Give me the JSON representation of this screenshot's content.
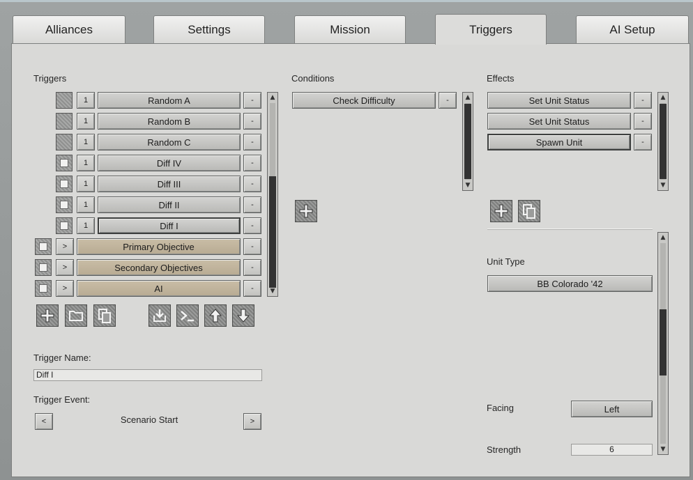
{
  "tabs": [
    {
      "label": "Alliances"
    },
    {
      "label": "Settings"
    },
    {
      "label": "Mission"
    },
    {
      "label": "Triggers"
    },
    {
      "label": "AI Setup"
    }
  ],
  "active_tab": "Triggers",
  "triggers": {
    "heading": "Triggers",
    "items": [
      {
        "count": "1",
        "label": "Random A",
        "checked": false
      },
      {
        "count": "1",
        "label": "Random B",
        "checked": false
      },
      {
        "count": "1",
        "label": "Random C",
        "checked": false
      },
      {
        "count": "1",
        "label": "Diff IV",
        "checked": true
      },
      {
        "count": "1",
        "label": "Diff III",
        "checked": true
      },
      {
        "count": "1",
        "label": "Diff II",
        "checked": true
      },
      {
        "count": "1",
        "label": "Diff I",
        "checked": true,
        "selected": true
      }
    ],
    "groups": [
      {
        "expand": ">",
        "label": "Primary Objective",
        "checked": true
      },
      {
        "expand": ">",
        "label": "Secondary Objectives",
        "checked": true
      },
      {
        "expand": ">",
        "label": "AI",
        "checked": true
      }
    ],
    "remove_label": "-",
    "trigger_name_label": "Trigger Name:",
    "trigger_name_value": "Diff I",
    "trigger_event_label": "Trigger Event:",
    "trigger_event_value": "Scenario Start",
    "prev_label": "<",
    "next_label": ">"
  },
  "conditions": {
    "heading": "Conditions",
    "items": [
      {
        "label": "Check Difficulty"
      }
    ],
    "remove_label": "-"
  },
  "effects": {
    "heading": "Effects",
    "items": [
      {
        "label": "Set Unit Status"
      },
      {
        "label": "Set Unit Status"
      },
      {
        "label": "Spawn Unit",
        "selected": true
      }
    ],
    "remove_label": "-",
    "unit_type_label": "Unit Type",
    "unit_type_value": "BB Colorado '42",
    "facing_label": "Facing",
    "facing_value": "Left",
    "strength_label": "Strength",
    "strength_value": "6"
  },
  "icons": {
    "add": "plus-icon",
    "folder": "folder-icon",
    "copy": "copy-icon",
    "import": "import-icon",
    "console": "console-icon",
    "up": "arrow-up-icon",
    "down": "arrow-down-icon"
  }
}
